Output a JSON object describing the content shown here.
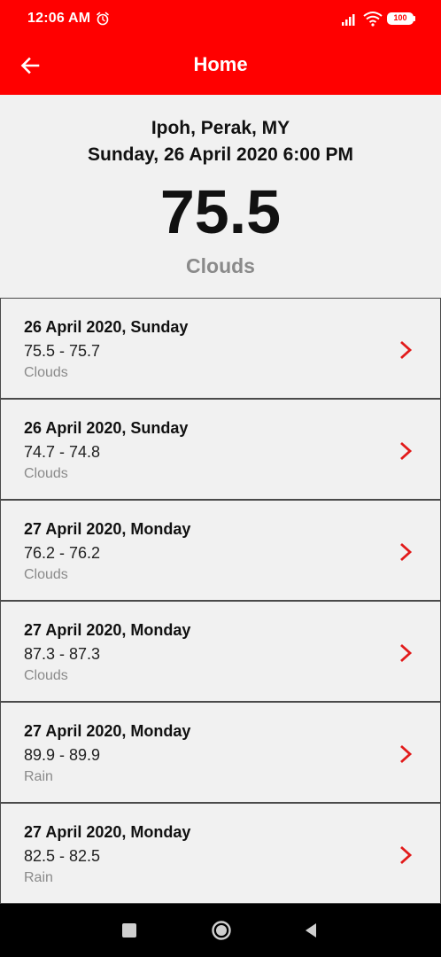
{
  "status_bar": {
    "time": "12:06 AM",
    "battery": "100",
    "icons": [
      "alarm-icon",
      "signal-icon",
      "wifi-icon",
      "battery-icon"
    ]
  },
  "app_bar": {
    "title": "Home",
    "back_icon": "arrow-left-icon",
    "color": "#ff0000"
  },
  "current": {
    "location": "Ipoh, Perak, MY",
    "datetime": "Sunday, 26 April 2020 6:00 PM",
    "temperature": "75.5",
    "condition": "Clouds"
  },
  "forecast": [
    {
      "date": "26 April 2020, Sunday",
      "range": "75.5 - 75.7",
      "condition": "Clouds"
    },
    {
      "date": "26 April 2020, Sunday",
      "range": "74.7 - 74.8",
      "condition": "Clouds"
    },
    {
      "date": "27 April 2020, Monday",
      "range": "76.2 - 76.2",
      "condition": "Clouds"
    },
    {
      "date": "27 April 2020, Monday",
      "range": "87.3 - 87.3",
      "condition": "Clouds"
    },
    {
      "date": "27 April 2020, Monday",
      "range": "89.9 - 89.9",
      "condition": "Rain"
    },
    {
      "date": "27 April 2020, Monday",
      "range": "82.5 - 82.5",
      "condition": "Rain"
    }
  ],
  "nav_bar": {
    "buttons": [
      "recents-button",
      "home-button",
      "back-button"
    ]
  },
  "colors": {
    "accent": "#ff0000",
    "background": "#f1f1f1",
    "secondary_text": "#8a8a8a"
  }
}
